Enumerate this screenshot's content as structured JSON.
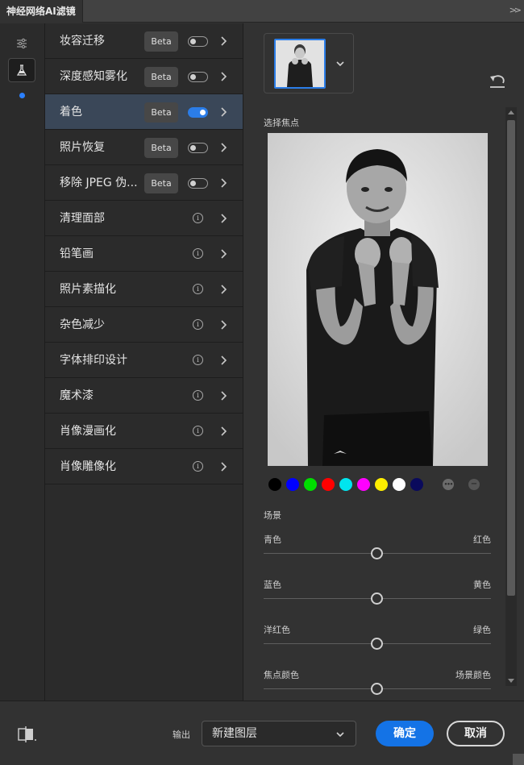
{
  "window": {
    "title": "神经网络AI滤镜"
  },
  "filters": [
    {
      "label": "妆容迁移",
      "beta": "Beta",
      "enabled": false
    },
    {
      "label": "深度感知雾化",
      "beta": "Beta",
      "enabled": false
    },
    {
      "label": "着色",
      "beta": "Beta",
      "enabled": true,
      "selected": true
    },
    {
      "label": "照片恢复",
      "beta": "Beta",
      "enabled": false
    },
    {
      "label": "移除 JPEG 伪...",
      "beta": "Beta",
      "enabled": false
    },
    {
      "label": "清理面部",
      "info": "i"
    },
    {
      "label": "铅笔画",
      "info": "i"
    },
    {
      "label": "照片素描化",
      "info": "i"
    },
    {
      "label": "杂色减少",
      "info": "i"
    },
    {
      "label": "字体排印设计",
      "info": "i"
    },
    {
      "label": "魔术漆",
      "info": "i"
    },
    {
      "label": "肖像漫画化",
      "info": "i"
    },
    {
      "label": "肖像雕像化",
      "info": "i"
    }
  ],
  "colorize": {
    "focus_label": "选择焦点",
    "swatches": [
      "#000000",
      "#0000ff",
      "#00dd00",
      "#ff0000",
      "#00e5ee",
      "#ff00ff",
      "#ffee00",
      "#ffffff",
      "#0a0a5c"
    ],
    "more_icon": "•••",
    "remove_icon": "−",
    "scene_label": "场景",
    "sliders": [
      {
        "left": "青色",
        "right": "红色",
        "value": 0.5
      },
      {
        "left": "蓝色",
        "right": "黄色",
        "value": 0.5
      },
      {
        "left": "洋红色",
        "right": "绿色",
        "value": 0.5
      },
      {
        "left": "焦点颜色",
        "right": "场景颜色",
        "value": 0.5
      }
    ]
  },
  "footer": {
    "output_label": "输出",
    "output_value": "新建图层",
    "ok": "确定",
    "cancel": "取消"
  },
  "colors": {
    "accent": "#1473e6",
    "selected_row": "#3a4758",
    "toggle_on": "#2b7de8"
  }
}
